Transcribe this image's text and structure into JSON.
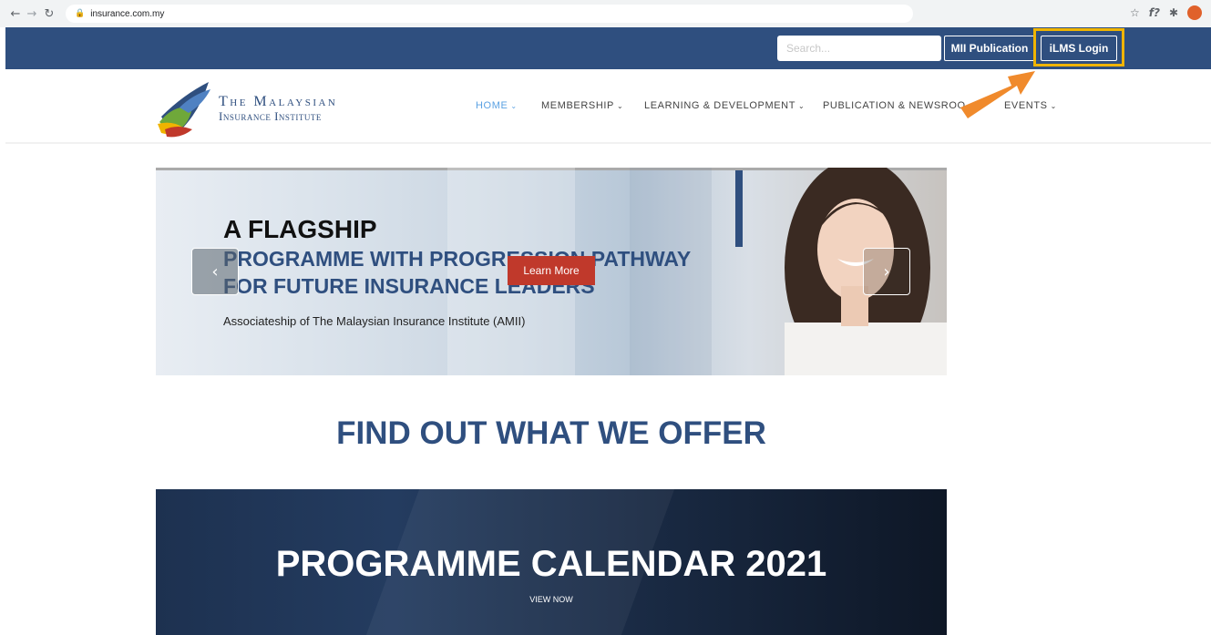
{
  "browser": {
    "url": "insurance.com.my",
    "back_icon": "back-arrow-icon",
    "forward_icon": "forward-arrow-icon",
    "reload_icon": "reload-icon",
    "lock_icon": "lock-icon",
    "star_icon": "star-icon",
    "extension_label": "f?",
    "puzzle_icon": "puzzle-icon"
  },
  "header": {
    "search_placeholder": "Search...",
    "mii_publication_label": "MII Publication",
    "ilms_login_label": "iLMS Login",
    "highlight_color": "#f0b400",
    "bar_color": "#2f4f7f"
  },
  "logo": {
    "line1": "The Malaysian",
    "line2": "Insurance Institute"
  },
  "nav": {
    "items": [
      {
        "label": "HOME",
        "active": true
      },
      {
        "label": "MEMBERSHIP",
        "active": false
      },
      {
        "label": "LEARNING & DEVELOPMENT",
        "active": false
      },
      {
        "label": "PUBLICATION & NEWSROO",
        "active": false
      },
      {
        "label": "EVENTS",
        "active": false
      }
    ]
  },
  "hero": {
    "title_line1": "A FLAGSHIP",
    "title_line2": "PROGRAMME WITH PROGRESSION PATHWAY",
    "title_line3": "FOR FUTURE INSURANCE LEADERS",
    "subtitle": "Associateship of The Malaysian Insurance Institute (AMII)",
    "cta_label": "Learn More",
    "prev_icon": "chevron-left-icon",
    "next_icon": "chevron-right-icon",
    "cta_color": "#c0392b"
  },
  "offer": {
    "title": "FIND OUT WHAT WE OFFER"
  },
  "calendar": {
    "title": "PROGRAMME CALENDAR 2021",
    "cta_label": "VIEW NOW"
  },
  "annotation": {
    "arrow_color": "#f08a2c"
  }
}
